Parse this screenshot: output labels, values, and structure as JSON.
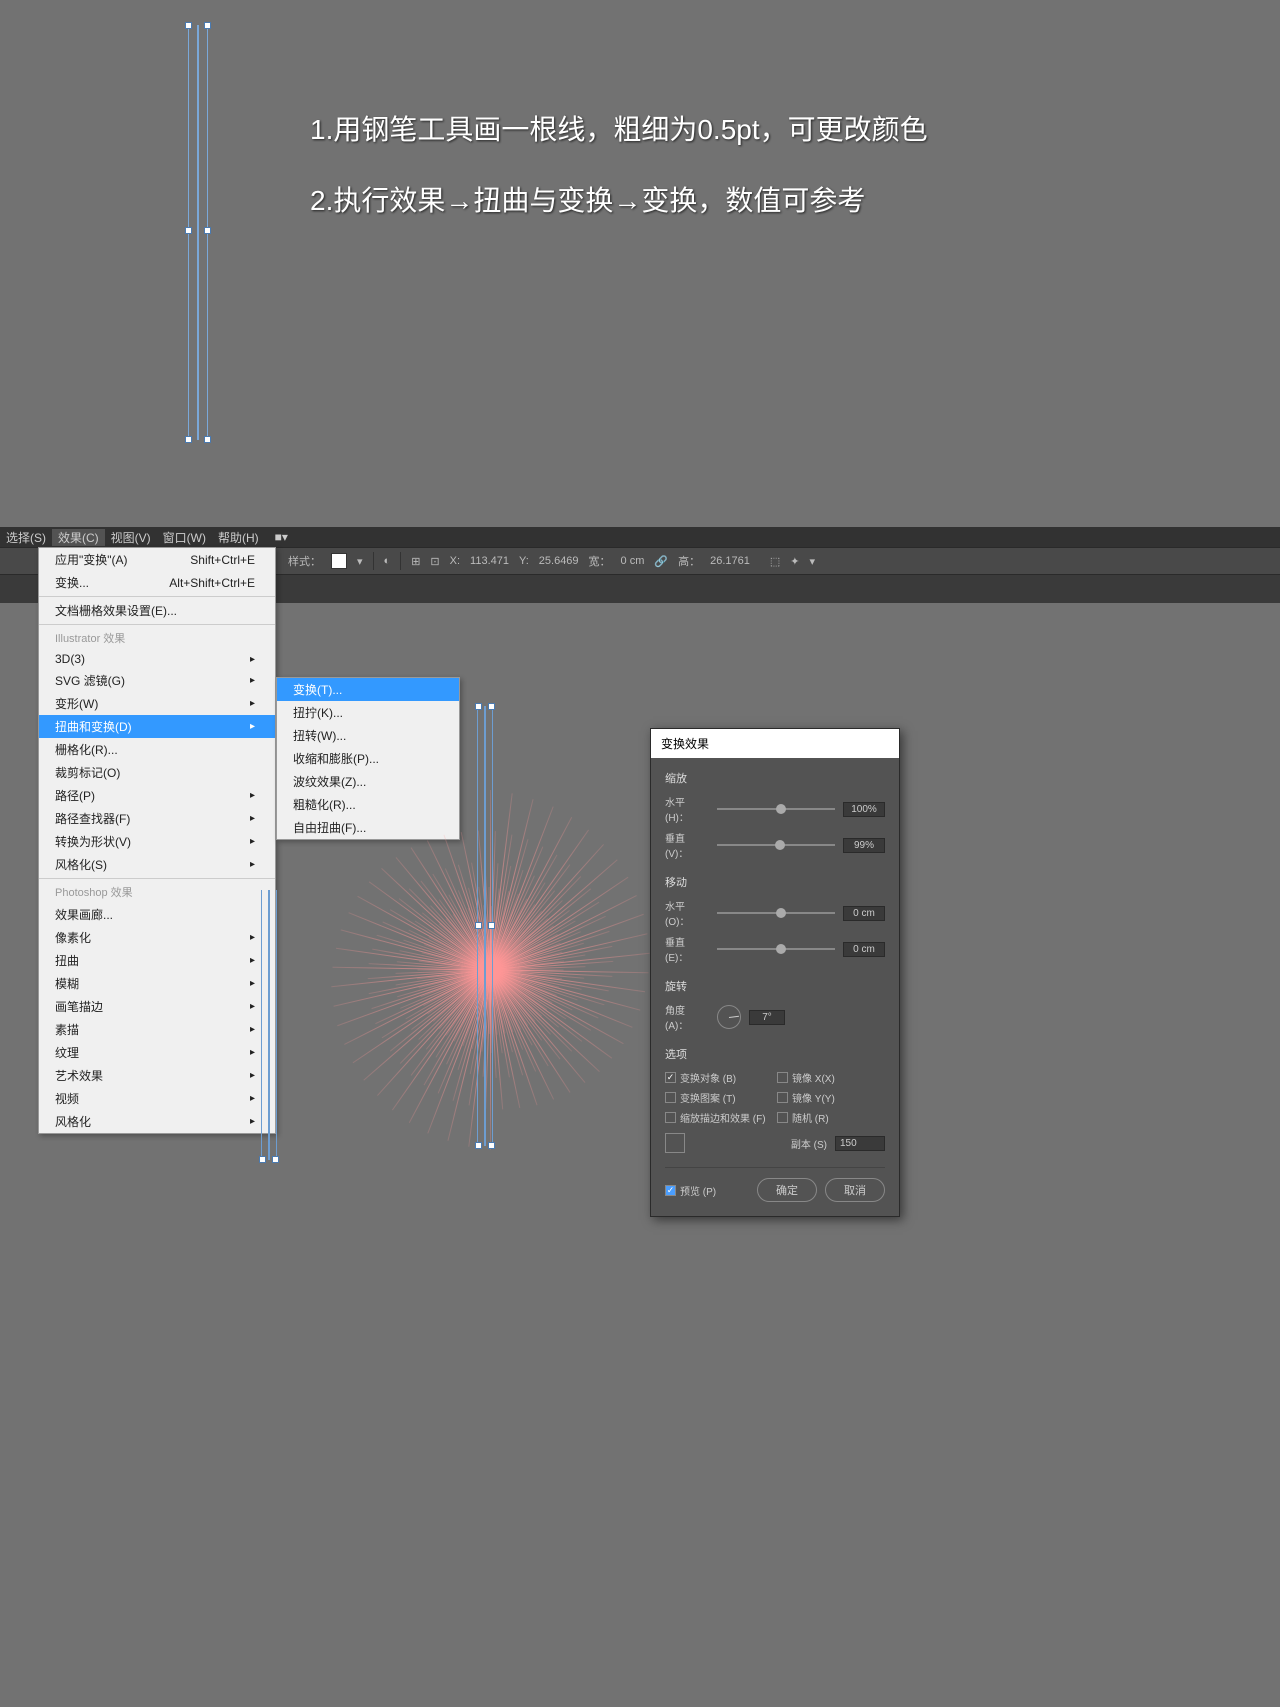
{
  "instructions": {
    "line1": "1.用钢笔工具画一根线，粗细为0.5pt，可更改颜色",
    "line2": "2.执行效果→扭曲与变换→变换，数值可参考"
  },
  "menubar": {
    "select": "选择(S)",
    "effect": "效果(C)",
    "view": "视图(V)",
    "window": "窗口(W)",
    "help": "帮助(H)"
  },
  "toolbar": {
    "style_label": "样式：",
    "x_label": "X:",
    "x_value": "113.471",
    "y_label": "Y:",
    "y_value": "25.6469",
    "w_label": "宽：",
    "w_value": "0 cm",
    "h_label": "高：",
    "h_value": "26.1761"
  },
  "menu": {
    "apply_transform": "应用\"变换\"(A)",
    "apply_shortcut": "Shift+Ctrl+E",
    "transform": "变换...",
    "transform_shortcut": "Alt+Shift+Ctrl+E",
    "doc_raster": "文档栅格效果设置(E)...",
    "illustrator_header": "Illustrator 效果",
    "item_3d": "3D(3)",
    "svg_filter": "SVG 滤镜(G)",
    "warp": "变形(W)",
    "distort_transform": "扭曲和变换(D)",
    "rasterize": "栅格化(R)...",
    "crop_marks": "裁剪标记(O)",
    "path": "路径(P)",
    "pathfinder": "路径查找器(F)",
    "convert_shape": "转换为形状(V)",
    "stylize": "风格化(S)",
    "photoshop_header": "Photoshop 效果",
    "effect_gallery": "效果画廊...",
    "pixelate": "像素化",
    "distort": "扭曲",
    "blur": "模糊",
    "brush_strokes": "画笔描边",
    "sketch": "素描",
    "texture": "纹理",
    "artistic": "艺术效果",
    "video": "视频",
    "stylize_ps": "风格化"
  },
  "submenu": {
    "transform": "变换(T)...",
    "twist": "扭拧(K)...",
    "tweak": "扭转(W)...",
    "pucker_bloat": "收缩和膨胀(P)...",
    "zigzag": "波纹效果(Z)...",
    "roughen": "粗糙化(R)...",
    "free_distort": "自由扭曲(F)..."
  },
  "dialog": {
    "title": "变换效果",
    "scale_label": "缩放",
    "horizontal": "水平 (H)：",
    "vertical": "垂直 (V)：",
    "scale_h_value": "100%",
    "scale_v_value": "99%",
    "move_label": "移动",
    "move_h": "水平 (O)：",
    "move_v": "垂直 (E)：",
    "move_h_value": "0 cm",
    "move_v_value": "0 cm",
    "rotate_label": "旋转",
    "angle_label": "角度 (A)：",
    "angle_value": "7°",
    "options_label": "选项",
    "transform_obj": "变换对象 (B)",
    "mirror_x": "镜像 X(X)",
    "transform_pattern": "变换图案 (T)",
    "mirror_y": "镜像 Y(Y)",
    "scale_stroke": "缩放描边和效果 (F)",
    "random": "随机 (R)",
    "copies_label": "副本 (S)",
    "copies_value": "150",
    "preview": "预览 (P)",
    "ok": "确定",
    "cancel": "取消"
  },
  "chart_data": {
    "type": "other",
    "description": "Adobe Illustrator radial starburst effect created by Transform effect with 150 copies rotated 7° each, 99% vertical scale"
  }
}
